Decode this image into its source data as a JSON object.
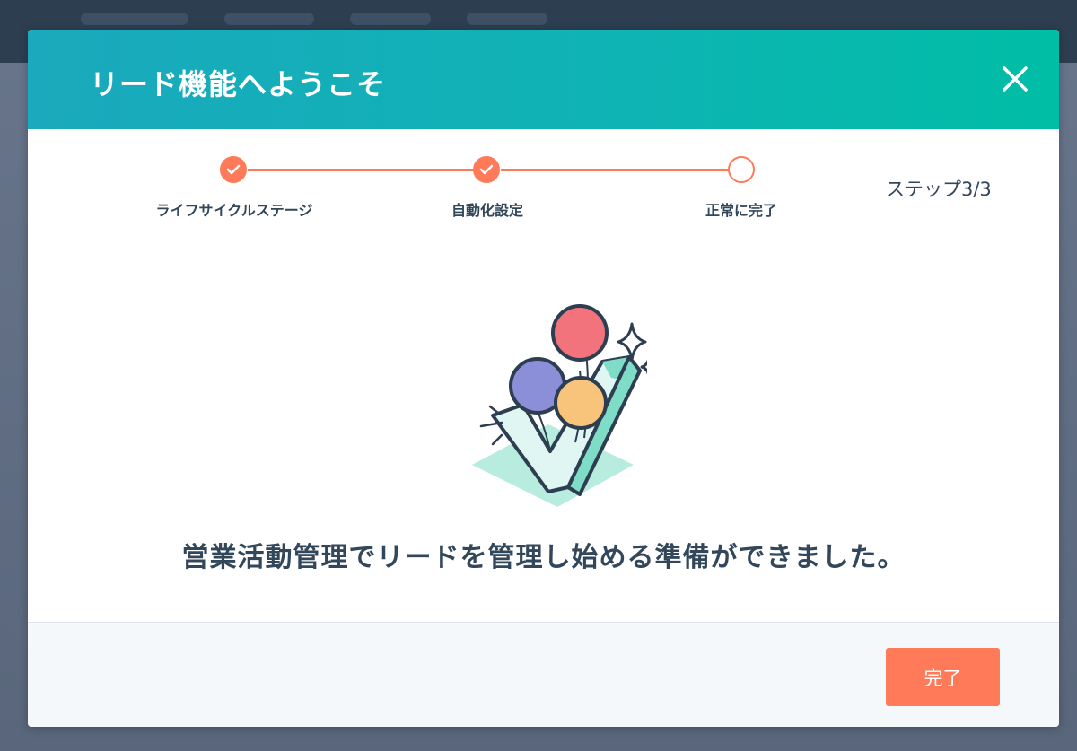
{
  "modal": {
    "title": "リード機能へようこそ",
    "close_icon": "close-icon",
    "steps": [
      {
        "label": "ライフサイクルステージ",
        "status": "done"
      },
      {
        "label": "自動化設定",
        "status": "done"
      },
      {
        "label": "正常に完了",
        "status": "current"
      }
    ],
    "step_count": "ステップ3/3",
    "message": "営業活動管理でリードを管理し始める準備ができました。",
    "done_button_label": "完了"
  },
  "colors": {
    "header_start": "#1aa9bd",
    "header_end": "#00bda5",
    "accent": "#ff7a59",
    "text": "#33475b"
  }
}
